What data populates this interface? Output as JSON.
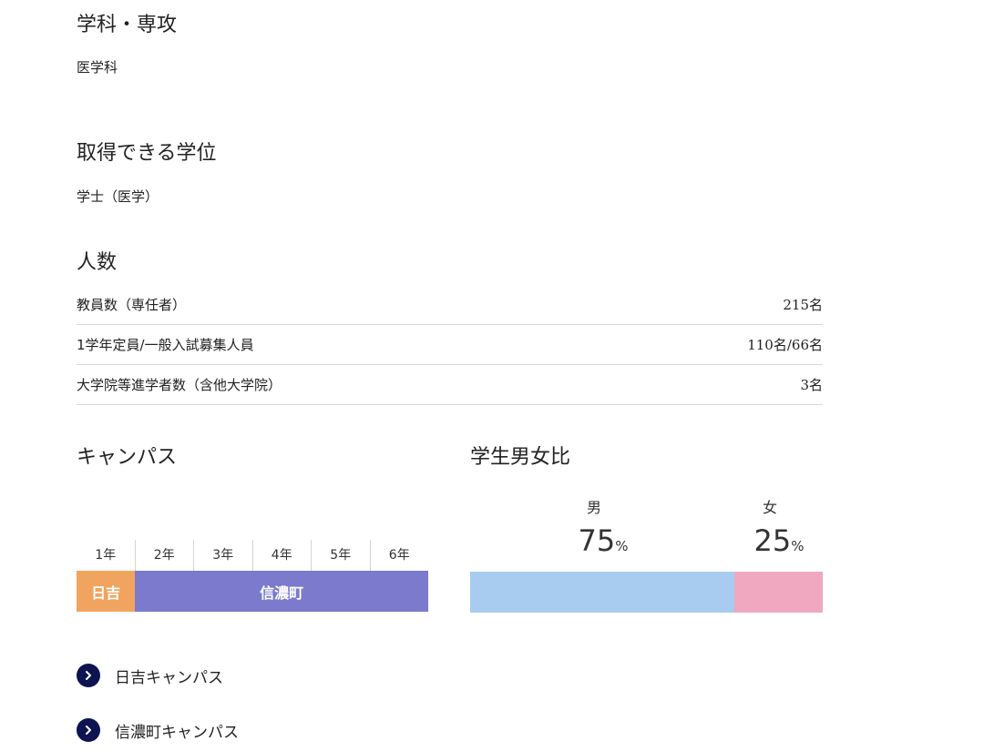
{
  "department": {
    "heading": "学科・専攻",
    "value": "医学科"
  },
  "degree": {
    "heading": "取得できる学位",
    "value": "学士（医学）"
  },
  "headcount": {
    "heading": "人数",
    "rows": [
      {
        "label": "教員数（専任者）",
        "value": "215名"
      },
      {
        "label": "1学年定員/一般入試募集人員",
        "value": "110名/66名"
      },
      {
        "label": "大学院等進学者数（含他大学院）",
        "value": "3名"
      }
    ]
  },
  "campus": {
    "heading": "キャンパス",
    "years": [
      "1年",
      "2年",
      "3年",
      "4年",
      "5年",
      "6年"
    ],
    "segments": [
      {
        "label": "日吉",
        "years_covered": 1,
        "color": "#f0a460"
      },
      {
        "label": "信濃町",
        "years_covered": 5,
        "color": "#7b7acc"
      }
    ]
  },
  "gender_ratio": {
    "heading": "学生男女比",
    "male": {
      "label": "男",
      "percent": "75",
      "unit": "%",
      "color": "#a8ccef"
    },
    "female": {
      "label": "女",
      "percent": "25",
      "unit": "%",
      "color": "#f0a8c0"
    }
  },
  "links": [
    {
      "label": "日吉キャンパス",
      "icon": "chevron-right-icon"
    },
    {
      "label": "信濃町キャンパス",
      "icon": "chevron-right-icon"
    }
  ],
  "colors": {
    "link_icon_bg": "#0d1450",
    "divider": "#d8d8d8"
  }
}
